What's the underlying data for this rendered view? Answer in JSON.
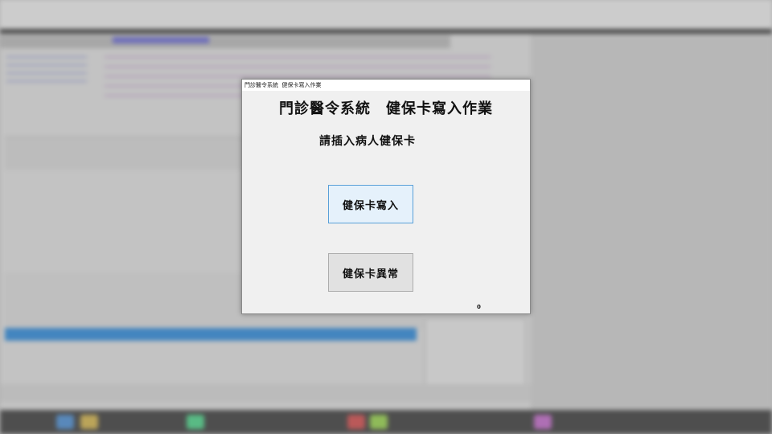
{
  "dialog": {
    "window_title": "門診醫令系統  健保卡寫入作業",
    "heading": "門診醫令系統　健保卡寫入作業",
    "instruction": "請插入病人健保卡",
    "write_button_label": "健保卡寫入",
    "error_button_label": "健保卡異常",
    "counter": "0"
  },
  "colors": {
    "dialog_bg": "#f0f0f0",
    "primary_button_bg": "#e5f1fb",
    "primary_button_border": "#5aa0d8",
    "secondary_button_bg": "#e1e1e1",
    "background_selection": "#2a8be0"
  }
}
